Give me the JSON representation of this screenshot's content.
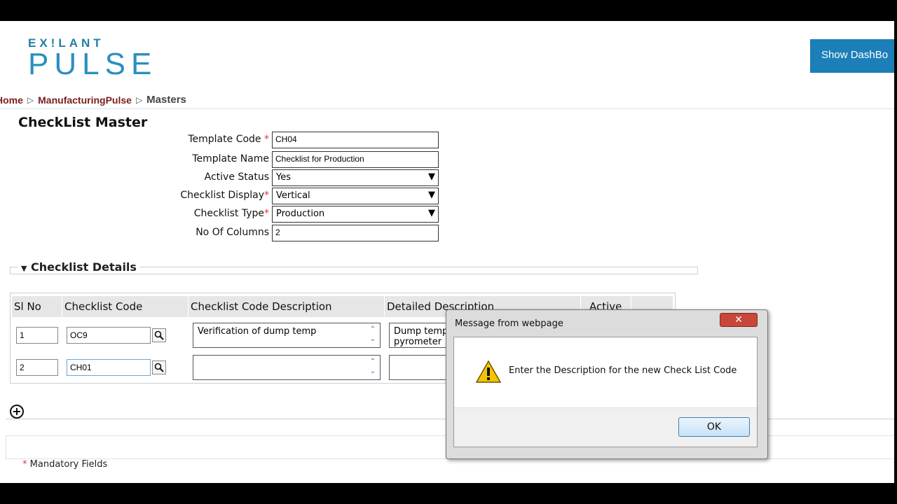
{
  "header": {
    "logo_top": "EX!LANT",
    "logo_main": "PULSE",
    "dashboard_button": "Show DashBo"
  },
  "breadcrumb": {
    "home": "Home",
    "section": "ManufacturingPulse",
    "current": "Masters"
  },
  "page_title": "CheckList Master",
  "form": {
    "template_code_label": "Template Code",
    "template_code_value": "CH04",
    "template_name_label": "Template Name",
    "template_name_value": "Checklist for Production",
    "active_status_label": "Active Status",
    "active_status_value": "Yes",
    "checklist_display_label": "Checklist Display",
    "checklist_display_value": "Vertical",
    "checklist_type_label": "Checklist Type",
    "checklist_type_value": "Production",
    "no_of_columns_label": "No Of Columns",
    "no_of_columns_value": "2",
    "required_mark": "*"
  },
  "details": {
    "section_title": "Checklist Details",
    "columns": [
      "Sl No",
      "Checklist Code",
      "Checklist Code Description",
      "Detailed Description",
      "Active"
    ],
    "rows": [
      {
        "sl_no": "1",
        "code": "OC9",
        "description": "Verification of dump temp",
        "detailed": "Dump temp\npyrometer"
      },
      {
        "sl_no": "2",
        "code": "CH01",
        "description": "",
        "detailed": ""
      }
    ]
  },
  "footer": {
    "mandatory_note": "Mandatory Fields",
    "required_mark": "*"
  },
  "dialog": {
    "title": "Message from webpage",
    "message": "Enter the Description for the new Check List Code",
    "ok_label": "OK",
    "close_label": "✕"
  },
  "colors": {
    "accent": "#1c7fb8",
    "breadcrumb": "#7a1e1e",
    "required": "#dd3333"
  }
}
